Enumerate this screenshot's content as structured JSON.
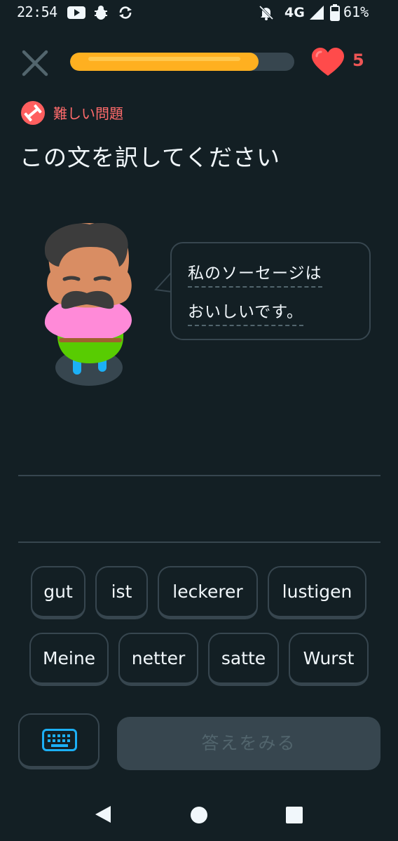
{
  "status_bar": {
    "time": "22:54",
    "network": "4G",
    "battery": "61%",
    "icons": [
      "youtube-icon",
      "bug-icon",
      "sync-icon",
      "notifications-off-icon",
      "signal-icon",
      "battery-icon"
    ]
  },
  "lesson": {
    "progress_fraction": 0.84,
    "hearts": "5",
    "colors": {
      "progress": "#ffb020",
      "heart": "#ff4b4b",
      "hard": "#ff5f5f"
    }
  },
  "challenge": {
    "difficulty_label": "難しい問題",
    "instruction": "この文を訳してください",
    "sentence_line1": "私のソーセージは",
    "sentence_line2": "おいしいです。"
  },
  "word_bank": {
    "row1": [
      "gut",
      "ist",
      "leckerer",
      "lustigen"
    ],
    "row2": [
      "Meine",
      "netter",
      "satte",
      "Wurst"
    ]
  },
  "actions": {
    "check_label": "答えをみる",
    "keyboard_icon": "keyboard-icon"
  },
  "nav": {
    "icons": [
      "back-icon",
      "home-icon",
      "recents-icon"
    ]
  }
}
